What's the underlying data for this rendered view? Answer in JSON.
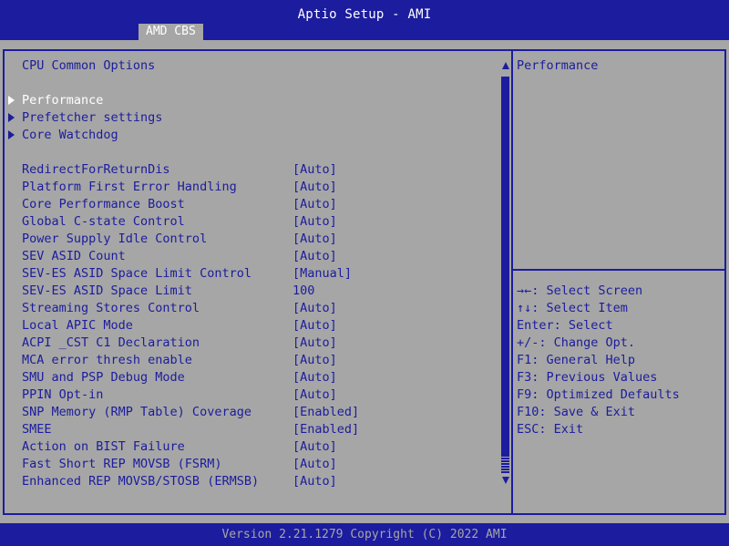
{
  "window": {
    "title": "Aptio Setup - AMI"
  },
  "tabs": [
    {
      "label": "AMD CBS"
    }
  ],
  "main": {
    "section_title": "CPU Common Options",
    "submenus": [
      {
        "label": "Performance"
      },
      {
        "label": "Prefetcher settings"
      },
      {
        "label": "Core Watchdog"
      }
    ],
    "options": [
      {
        "label": "RedirectForReturnDis",
        "value": "[Auto]"
      },
      {
        "label": "Platform First Error Handling",
        "value": "[Auto]"
      },
      {
        "label": "Core Performance Boost",
        "value": "[Auto]"
      },
      {
        "label": "Global C-state Control",
        "value": "[Auto]"
      },
      {
        "label": "Power Supply Idle Control",
        "value": "[Auto]"
      },
      {
        "label": "SEV ASID Count",
        "value": "[Auto]"
      },
      {
        "label": "SEV-ES ASID Space Limit Control",
        "value": "[Manual]"
      },
      {
        "label": "SEV-ES ASID Space Limit",
        "value": "100"
      },
      {
        "label": "Streaming Stores Control",
        "value": "[Auto]"
      },
      {
        "label": "Local APIC Mode",
        "value": "[Auto]"
      },
      {
        "label": "ACPI _CST C1 Declaration",
        "value": "[Auto]"
      },
      {
        "label": "MCA error thresh enable",
        "value": "[Auto]"
      },
      {
        "label": "SMU and PSP Debug Mode",
        "value": "[Auto]"
      },
      {
        "label": "PPIN Opt-in",
        "value": "[Auto]"
      },
      {
        "label": "SNP Memory (RMP Table) Coverage",
        "value": "[Enabled]"
      },
      {
        "label": "SMEE",
        "value": "[Enabled]"
      },
      {
        "label": "Action on BIST Failure",
        "value": "[Auto]"
      },
      {
        "label": "Fast Short REP MOVSB (FSRM)",
        "value": "[Auto]"
      },
      {
        "label": "Enhanced REP MOVSB/STOSB (ERMSB)",
        "value": "[Auto]"
      }
    ]
  },
  "help": {
    "description": "Performance",
    "keys": [
      "→←: Select Screen",
      "↑↓: Select Item",
      "Enter: Select",
      "+/-: Change Opt.",
      "F1: General Help",
      "F3: Previous Values",
      "F9: Optimized Defaults",
      "F10: Save & Exit",
      "ESC: Exit"
    ]
  },
  "footer": {
    "text": "Version 2.21.1279 Copyright (C) 2022 AMI"
  },
  "colors": {
    "background": "#a6a6a6",
    "accent": "#1c1c9e",
    "highlight": "#ffffff"
  }
}
